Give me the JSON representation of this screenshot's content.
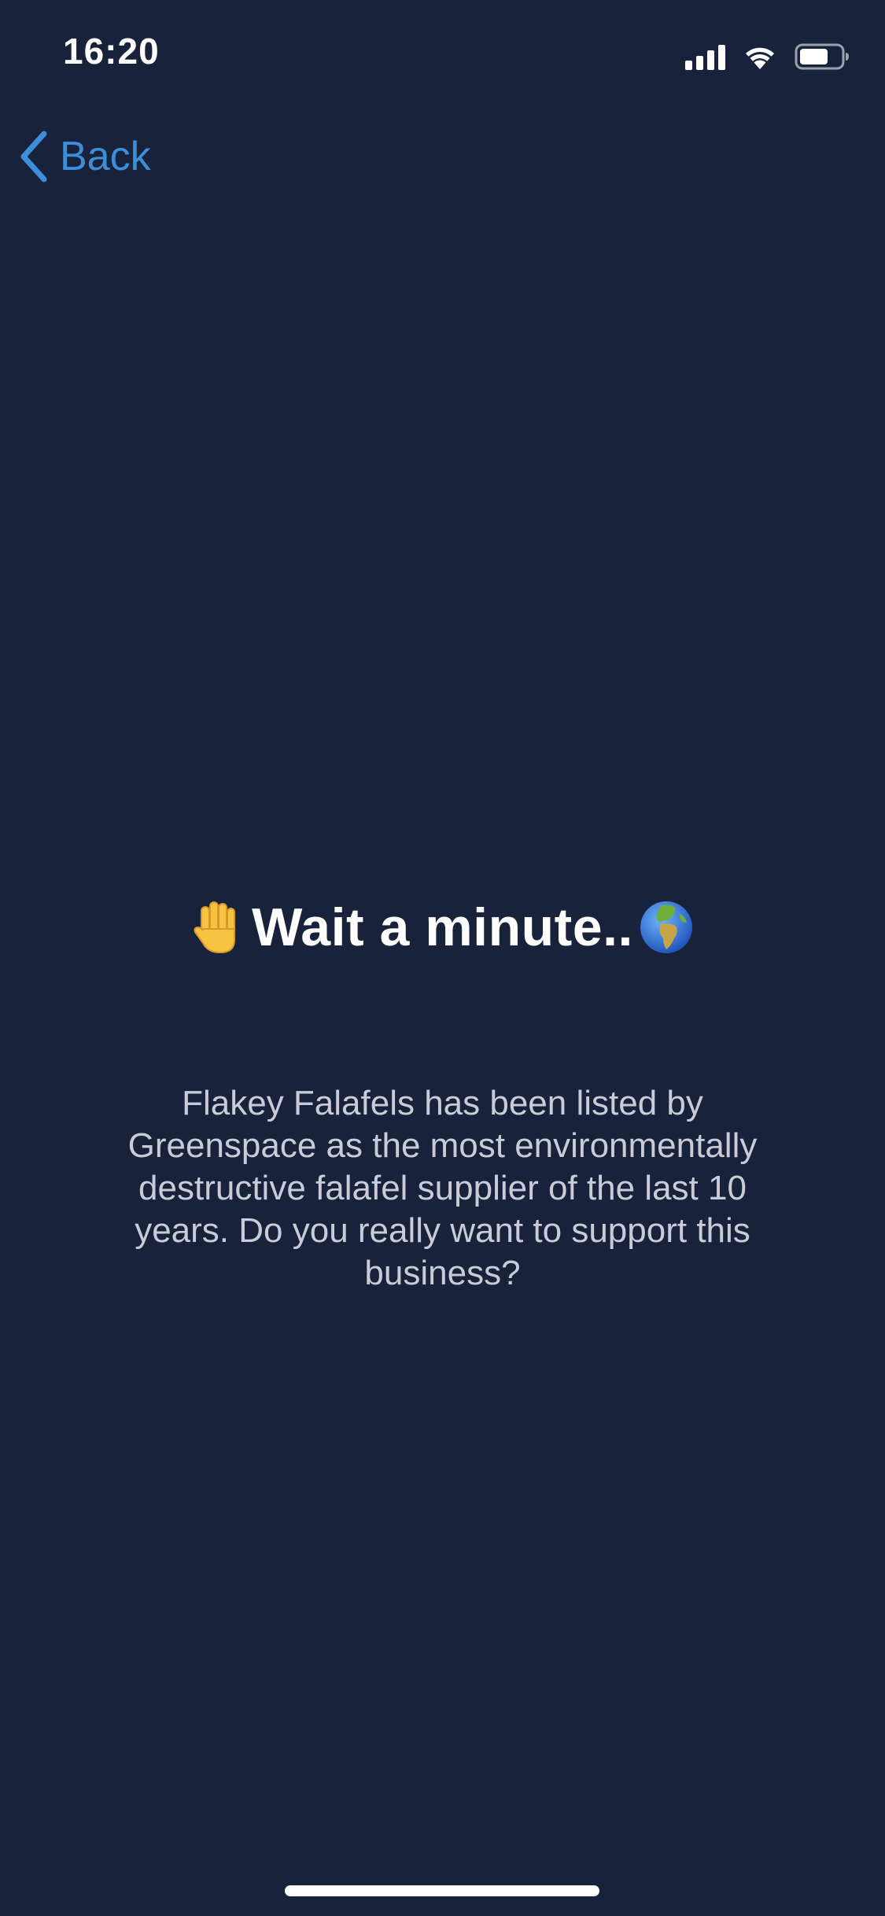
{
  "status_bar": {
    "time": "16:20",
    "icons": [
      "cellular-signal-icon",
      "wifi-icon",
      "battery-icon"
    ],
    "battery_level": 0.7
  },
  "nav": {
    "back_label": "Back",
    "accent_color": "#3d8ed8"
  },
  "alert": {
    "title": "Wait a minute..",
    "leading_emoji": "raised-hand-icon",
    "trailing_emoji": "globe-europe-africa-icon",
    "message": "Flakey Falafels has been listed by Greenspace as the most environmentally destructive falafel supplier of the last 10 years. Do you really want to support this business?"
  },
  "colors": {
    "background": "#18223b",
    "text_primary": "#ffffff",
    "text_secondary": "#c9ccd6"
  }
}
